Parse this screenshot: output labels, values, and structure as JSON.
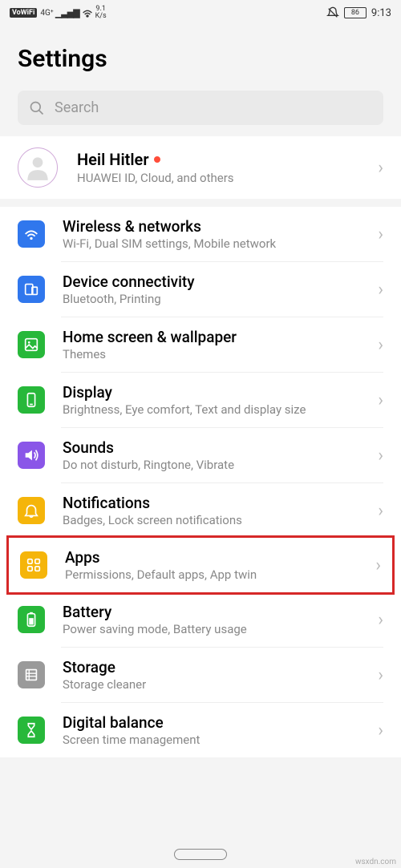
{
  "status": {
    "vowifi": "VoWiFi",
    "signal": "4G⁺",
    "speed_top": "9.1",
    "speed_bot": "K/s",
    "battery": "86",
    "time": "9:13"
  },
  "header": {
    "title": "Settings"
  },
  "search": {
    "placeholder": "Search"
  },
  "profile": {
    "name": "Heil Hitler",
    "sub": "HUAWEI ID, Cloud, and others"
  },
  "items": [
    {
      "title": "Wireless & networks",
      "sub": "Wi-Fi, Dual SIM settings, Mobile network",
      "color": "#3077ed",
      "icon": "wifi"
    },
    {
      "title": "Device connectivity",
      "sub": "Bluetooth, Printing",
      "color": "#3077ed",
      "icon": "device"
    },
    {
      "title": "Home screen & wallpaper",
      "sub": "Themes",
      "color": "#27b83a",
      "icon": "wallpaper"
    },
    {
      "title": "Display",
      "sub": "Brightness, Eye comfort, Text and display size",
      "color": "#27b83a",
      "icon": "display"
    },
    {
      "title": "Sounds",
      "sub": "Do not disturb, Ringtone, Vibrate",
      "color": "#8a56e8",
      "icon": "sound"
    },
    {
      "title": "Notifications",
      "sub": "Badges, Lock screen notifications",
      "color": "#f5b50a",
      "icon": "bell"
    },
    {
      "title": "Apps",
      "sub": "Permissions, Default apps, App twin",
      "color": "#f5b50a",
      "icon": "apps",
      "highlight": true
    },
    {
      "title": "Battery",
      "sub": "Power saving mode, Battery usage",
      "color": "#27b83a",
      "icon": "battery"
    },
    {
      "title": "Storage",
      "sub": "Storage cleaner",
      "color": "#9a9a9a",
      "icon": "storage"
    },
    {
      "title": "Digital balance",
      "sub": "Screen time management",
      "color": "#27b83a",
      "icon": "hourglass"
    }
  ],
  "watermark": "wsxdn.com"
}
